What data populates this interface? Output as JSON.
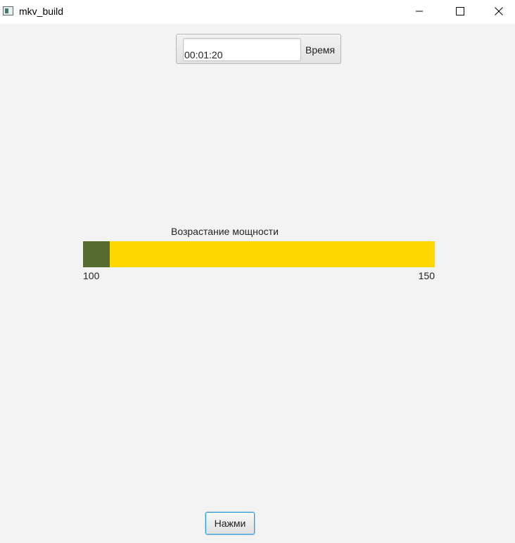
{
  "window": {
    "title": "mkv_build",
    "icon": "app-window-icon",
    "controls": {
      "minimize_icon": "minimize-icon",
      "maximize_icon": "maximize-icon",
      "close_icon": "close-icon"
    }
  },
  "timer": {
    "value": "00:01:20",
    "label": "Время"
  },
  "gauge": {
    "title": "Возрастание мощности",
    "min_label": "100",
    "max_label": "150",
    "min": 100,
    "max": 150,
    "current": 103.8,
    "fill_color": "#556b2f",
    "track_color": "#ffd700"
  },
  "actions": {
    "press_label": "Нажми"
  }
}
